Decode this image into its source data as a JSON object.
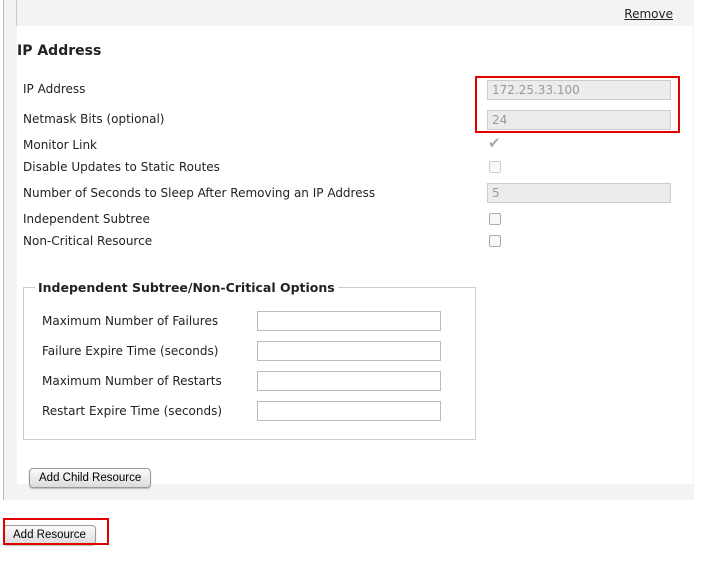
{
  "top": {
    "remove_label": "Remove"
  },
  "section": {
    "title": "IP Address"
  },
  "fields": [
    {
      "label": "IP Address",
      "value": "172.25.33.100"
    },
    {
      "label": "Netmask Bits (optional)",
      "value": "24"
    },
    {
      "label": "Monitor Link",
      "checked": true
    },
    {
      "label": "Disable Updates to Static Routes",
      "checked": false
    },
    {
      "label": "Number of Seconds to Sleep After Removing an IP Address",
      "value": "5"
    },
    {
      "label": "Independent Subtree",
      "checked": false
    },
    {
      "label": "Non-Critical Resource",
      "checked": false
    }
  ],
  "options": {
    "legend": "Independent Subtree/Non-Critical Options",
    "fields": [
      {
        "label": "Maximum Number of Failures",
        "value": ""
      },
      {
        "label": "Failure Expire Time (seconds)",
        "value": ""
      },
      {
        "label": "Maximum Number of Restarts",
        "value": ""
      },
      {
        "label": "Restart Expire Time (seconds)",
        "value": ""
      }
    ]
  },
  "buttons": {
    "add_child": "Add Child Resource",
    "add_resource": "Add Resource"
  },
  "colors": {
    "highlight": "#e00000"
  }
}
